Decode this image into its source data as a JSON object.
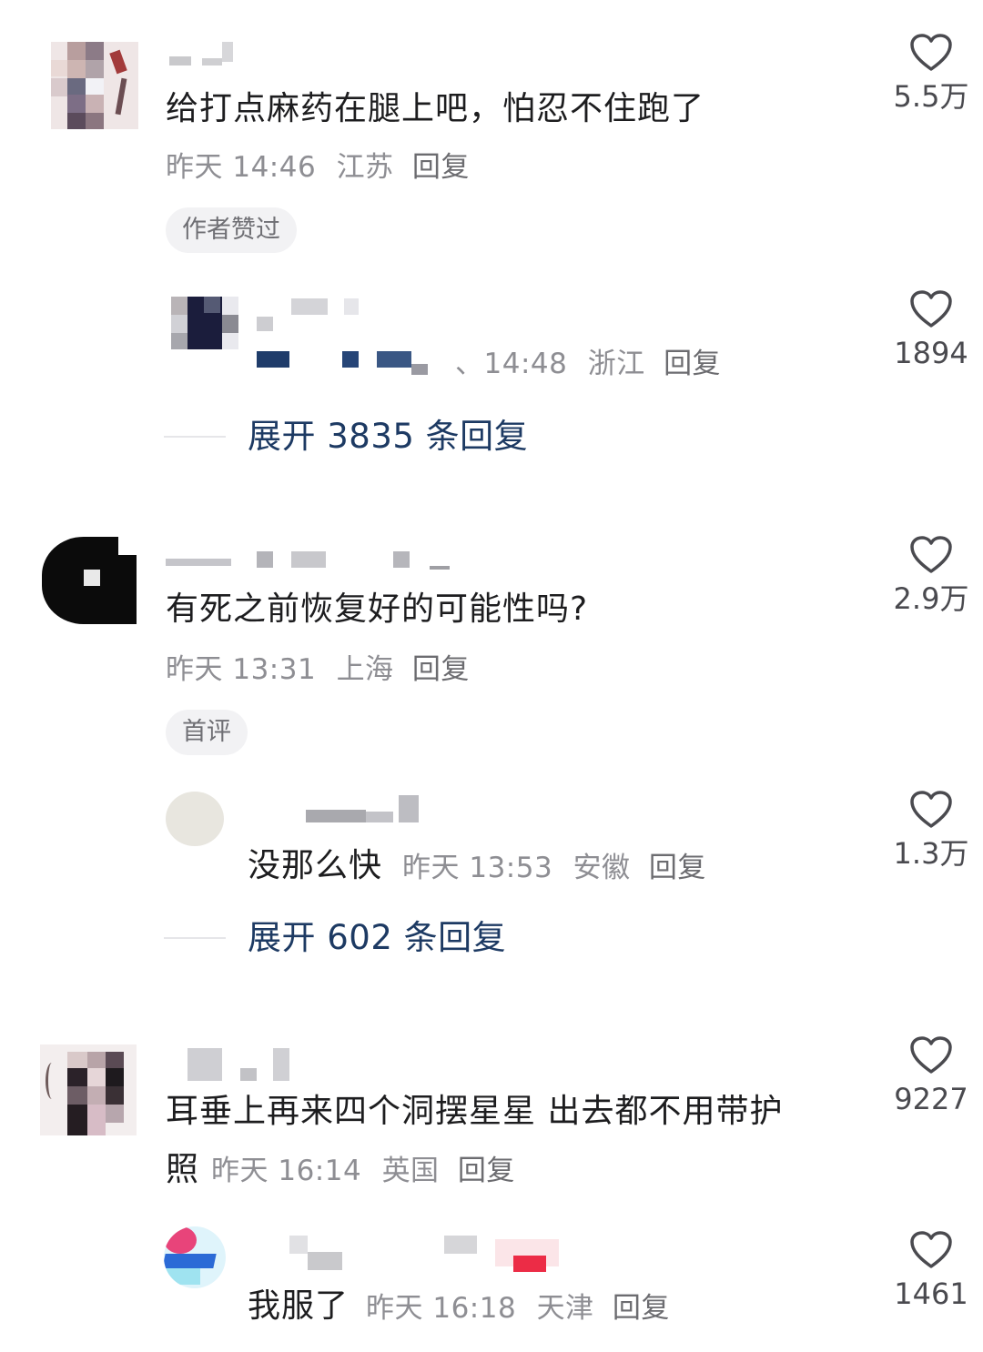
{
  "comments": [
    {
      "text": "给打点麻药在腿上吧，怕忍不住跑了",
      "time": "昨天 14:46",
      "location": "江苏",
      "reply_label": "回复",
      "badge": "作者赞过",
      "likes": "5.5万",
      "sub_reply": {
        "time": "、14:48",
        "location": "浙江",
        "reply_label": "回复",
        "likes": "1894"
      },
      "expand_label": "展开 3835 条回复"
    },
    {
      "text": "有死之前恢复好的可能性吗?",
      "time": "昨天 13:31",
      "location": "上海",
      "reply_label": "回复",
      "badge": "首评",
      "likes": "2.9万",
      "sub_reply": {
        "text": "没那么快",
        "time": "昨天 13:53",
        "location": "安徽",
        "reply_label": "回复",
        "likes": "1.3万"
      },
      "expand_label": "展开 602 条回复"
    },
    {
      "text_line1": "耳垂上再来四个洞摆星星 出去都不用带护",
      "text_line2": "照",
      "time": "昨天 16:14",
      "location": "英国",
      "reply_label": "回复",
      "likes": "9227",
      "sub_reply": {
        "text": "我服了",
        "time": "昨天 16:18",
        "location": "天津",
        "reply_label": "回复",
        "likes": "1461"
      }
    }
  ],
  "icons": {
    "like": "heart-outline-icon"
  },
  "colors": {
    "text": "#1d1d1f",
    "meta": "#8e8e93",
    "expand": "#1d3a63"
  }
}
